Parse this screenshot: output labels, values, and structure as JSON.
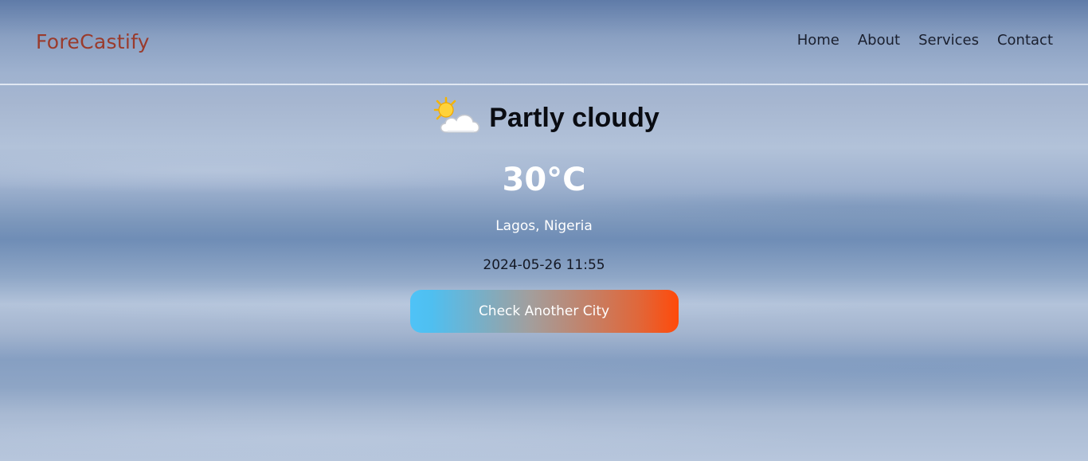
{
  "header": {
    "logo": "ForeCastify",
    "nav": [
      "Home",
      "About",
      "Services",
      "Contact"
    ]
  },
  "weather": {
    "icon": "sun-behind-cloud-icon",
    "condition": "Partly cloudy",
    "temperature": "30°C",
    "location": "Lagos, Nigeria",
    "datetime": "2024-05-26 11:55",
    "button_label": "Check Another City"
  },
  "colors": {
    "logo": "#9a3b2c",
    "button_gradient_start": "#4fc3f7",
    "button_gradient_end": "#ff4a0a"
  }
}
